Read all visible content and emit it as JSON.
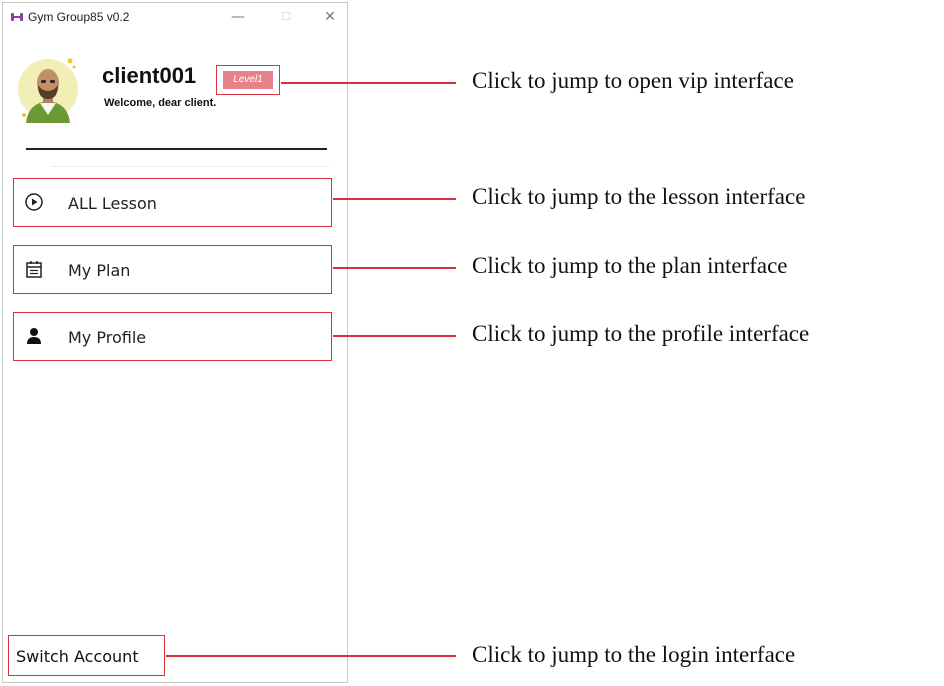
{
  "window": {
    "title": "Gym Group85 v0.2",
    "controls": {
      "minimize": "—",
      "maximize": "☐",
      "close": "✕"
    }
  },
  "profile": {
    "username": "client001",
    "level": "Level1",
    "welcome": "Welcome, dear client."
  },
  "menu": {
    "items": [
      {
        "label": "ALL Lesson",
        "icon": "play-circle-icon"
      },
      {
        "label": "My Plan",
        "icon": "calendar-icon"
      },
      {
        "label": "My Profile",
        "icon": "person-icon"
      }
    ]
  },
  "footer": {
    "switch_account": "Switch Account"
  },
  "annotations": [
    "Click to jump to open vip interface",
    "Click to jump to the lesson interface",
    "Click to jump to the plan interface",
    "Click to jump to the profile interface",
    "Click to jump to the login interface"
  ],
  "colors": {
    "highlight": "#d9323e",
    "badge": "#e8828a",
    "app_icon": "#8a3fa0"
  }
}
